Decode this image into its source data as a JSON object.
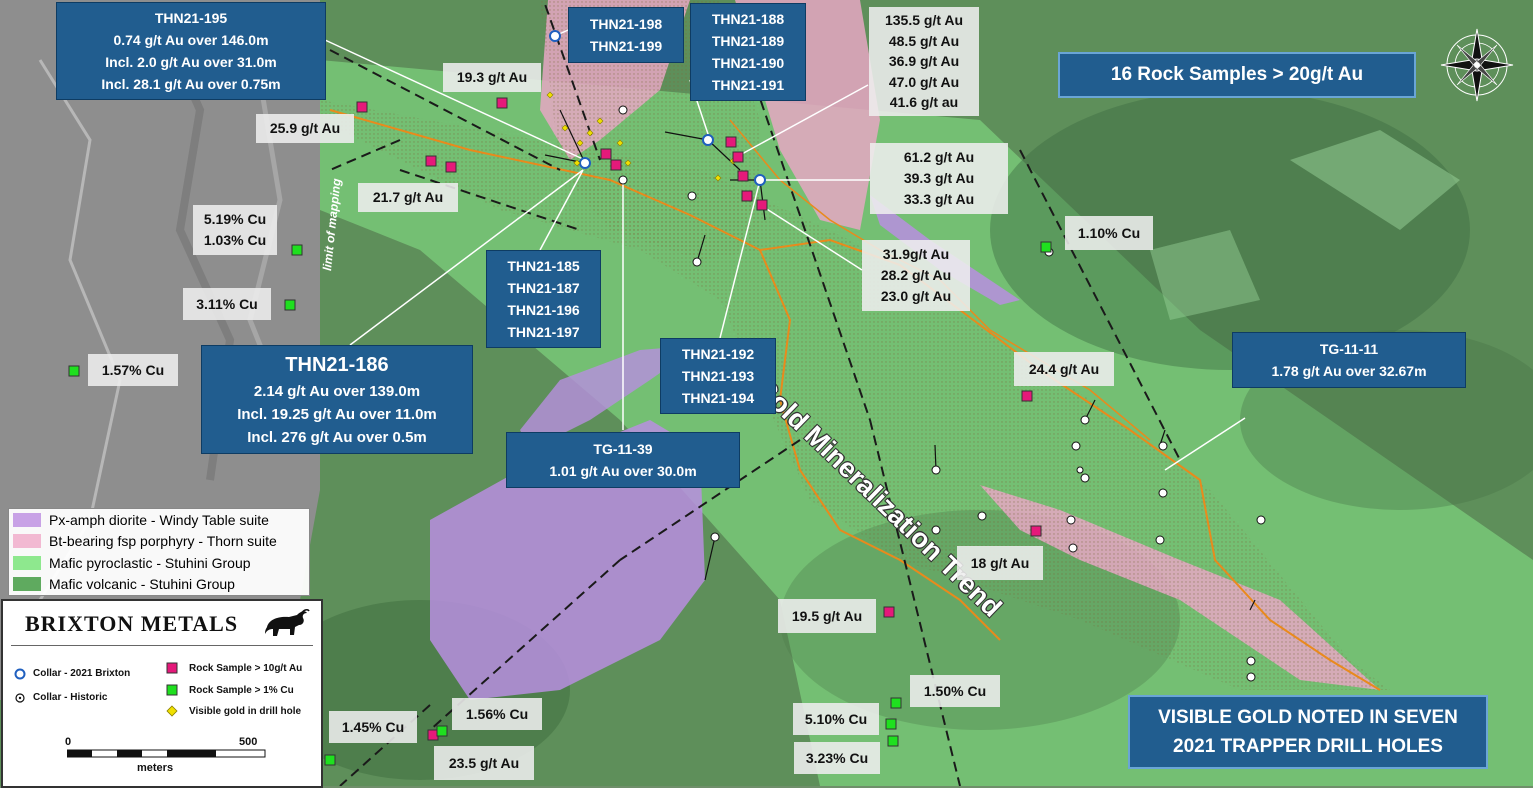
{
  "callouts": {
    "thn195": [
      "THN21-195",
      "0.74 g/t Au over 146.0m",
      "Incl. 2.0 g/t Au over 31.0m",
      "Incl. 28.1 g/t Au over 0.75m"
    ],
    "thn198": [
      "THN21-198",
      "THN21-199"
    ],
    "thn188": [
      "THN21-188",
      "THN21-189",
      "THN21-190",
      "THN21-191"
    ],
    "thn185": [
      "THN21-185",
      "THN21-187",
      "THN21-196",
      "THN21-197"
    ],
    "thn186": [
      "THN21-186",
      "2.14 g/t Au over 139.0m",
      "Incl. 19.25 g/t Au over 11.0m",
      "Incl. 276 g/t Au over 0.5m"
    ],
    "thn192": [
      "THN21-192",
      "THN21-193",
      "THN21-194"
    ],
    "tg1139": [
      "TG-11-39",
      "1.01 g/t Au over 30.0m"
    ],
    "tg1111": [
      "TG-11-11",
      "1.78 g/t Au over 32.67m"
    ],
    "rock_samples": "16 Rock Samples > 20g/t Au",
    "visible_gold": [
      "VISIBLE GOLD NOTED IN SEVEN",
      "2021 TRAPPER DRILL HOLES"
    ]
  },
  "labels": {
    "a19_3": "19.3 g/t Au",
    "a25_9": "25.9 g/t Au",
    "a21_7": "21.7 g/t Au",
    "cu519": [
      "5.19% Cu",
      "1.03% Cu"
    ],
    "cu311": "3.11% Cu",
    "cu157": "1.57% Cu",
    "a135": [
      "135.5 g/t Au",
      "48.5 g/t Au",
      "36.9 g/t Au",
      "47.0 g/t Au",
      "41.6 g/t au"
    ],
    "a61": [
      "61.2 g/t Au",
      "39.3 g/t Au",
      "33.3 g/t Au"
    ],
    "a31": [
      "31.9g/t Au",
      "28.2 g/t Au",
      "23.0 g/t Au"
    ],
    "cu110": "1.10% Cu",
    "a24_4": "24.4 g/t Au",
    "a18": "18 g/t Au",
    "a19_5": "19.5 g/t Au",
    "cu150": "1.50% Cu",
    "cu510": "5.10% Cu",
    "cu323": "3.23% Cu",
    "cu145": "1.45% Cu",
    "cu156": "1.56% Cu",
    "a23_5": "23.5 g/t Au"
  },
  "map_text": {
    "trend": "Gold Mineralization Trend",
    "limit": "limit of mapping"
  },
  "legend": {
    "units": [
      {
        "label": "Px-amph diorite - Windy Table suite",
        "color": "#c8a2e6"
      },
      {
        "label": "Bt-bearing fsp porphyry - Thorn suite",
        "color": "#f2b9d2"
      },
      {
        "label": "Mafic pyroclastic - Stuhini Group",
        "color": "#8ee88e"
      },
      {
        "label": "Mafic volcanic - Stuhini Group",
        "color": "#5faa5f"
      }
    ],
    "brand": "BRIXTON METALS",
    "symbols": {
      "collar_2021": "Collar - 2021 Brixton",
      "collar_hist": "Collar - Historic",
      "rock_au": "Rock Sample > 10g/t Au",
      "rock_cu": "Rock Sample > 1% Cu",
      "vis_gold": "Visible gold in drill hole"
    },
    "scale": {
      "start": "0",
      "end": "500",
      "unit": "meters"
    }
  },
  "colors": {
    "label_blue": "#215d8f",
    "au_sample": "#e5197a",
    "cu_sample": "#1fe01f",
    "contact": "#e98a1c",
    "visible_gold": "#f0e000"
  }
}
